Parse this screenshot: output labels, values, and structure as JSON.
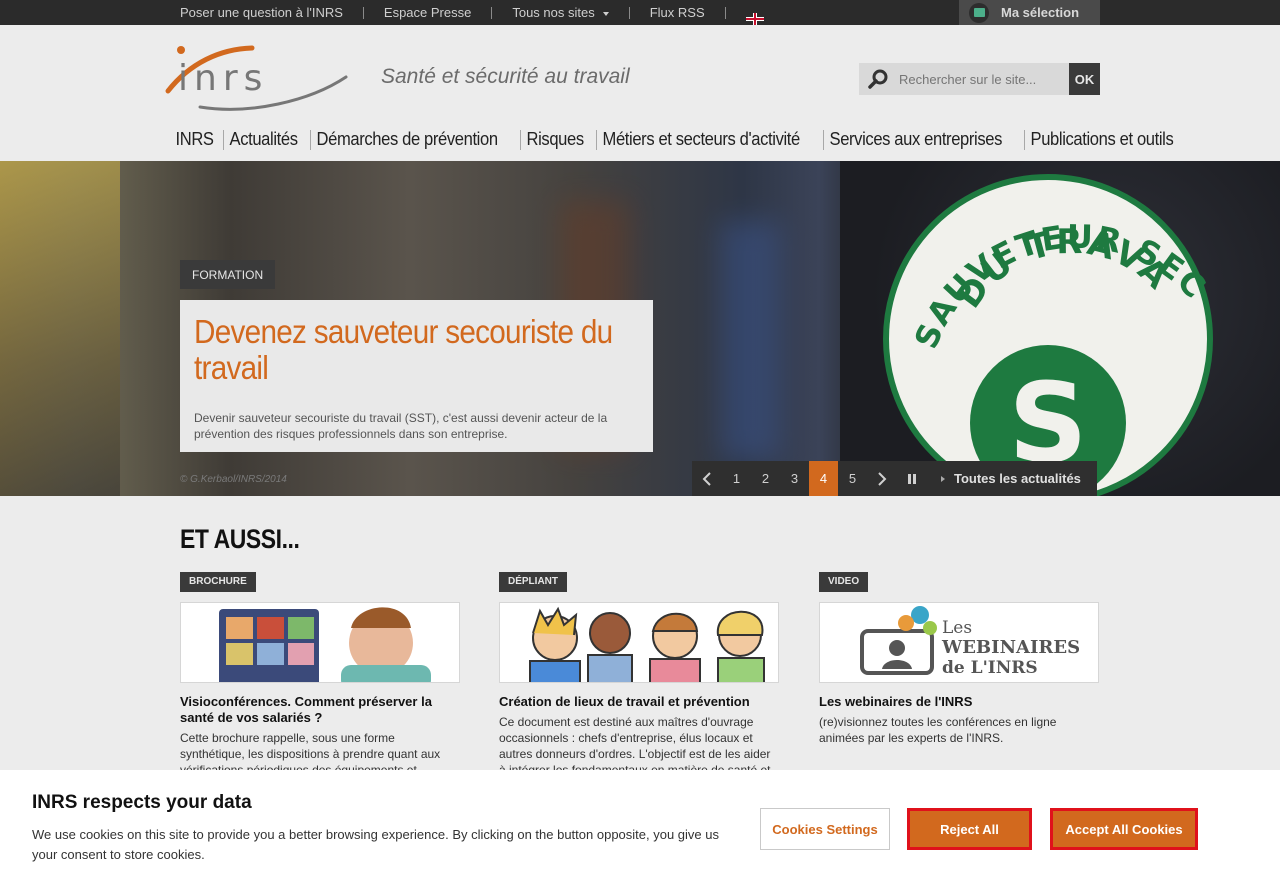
{
  "topbar": {
    "links": [
      "Poser une question à l'INRS",
      "Espace Presse",
      "Tous nos sites",
      "Flux RSS"
    ],
    "language_icon": "uk-flag-icon",
    "selection_label": "Ma sélection"
  },
  "header": {
    "logo_text": "inrs",
    "tagline": "Santé et sécurité au travail",
    "search": {
      "placeholder": "Rechercher sur le site...",
      "button": "OK"
    }
  },
  "nav": [
    "INRS",
    "Actualités",
    "Démarches de prévention",
    "Risques",
    "Métiers et secteurs d'activité",
    "Services aux entreprises",
    "Publications et outils"
  ],
  "hero": {
    "tag": "FORMATION",
    "title": "Devenez sauveteur secouriste du travail",
    "description": "Devenir sauveteur secouriste du travail (SST), c'est aussi devenir acteur de la prévention des risques professionnels dans son entreprise.",
    "credit": "© G.Kerbaol/INRS/2014",
    "badge_text_top": "SAUVETEUR SECOURISTE",
    "badge_text_mid": "DU TRAVAIL",
    "badge_letter": "S",
    "pages": [
      "1",
      "2",
      "3",
      "4",
      "5"
    ],
    "active_page": "4",
    "all_news": "Toutes les actualités",
    "accent": "#d2691e"
  },
  "aussi": {
    "title": "ET AUSSI...",
    "items": [
      {
        "badge": "BROCHURE",
        "title": "Visioconférences. Comment préserver la santé de vos salariés ?",
        "text": "Cette brochure rappelle, sous une forme synthétique, les dispositions à prendre quant aux vérifications périodiques des équipements et"
      },
      {
        "badge": "DÉPLIANT",
        "title": "Création de lieux de travail et prévention",
        "text": "Ce document est destiné aux maîtres d'ouvrage occasionnels : chefs d'entreprise, élus locaux et autres donneurs d'ordres. L'objectif est de les aider à intégrer les fondamentaux en matière de santé et"
      },
      {
        "badge": "VIDEO",
        "title": "Les webinaires de l'INRS",
        "text": "(re)visionnez toutes les conférences en ligne animées par les experts de l'INRS.",
        "thumb_line1": "Les",
        "thumb_line2": "WEBINAIRES",
        "thumb_line3": "de L'INRS"
      }
    ]
  },
  "cookie": {
    "title": "INRS respects your data",
    "text": "We use cookies on this site to provide you a better browsing experience. By clicking on the button opposite, you give us your consent to store cookies.",
    "settings": "Cookies Settings",
    "reject": "Reject All",
    "accept": "Accept All Cookies"
  }
}
